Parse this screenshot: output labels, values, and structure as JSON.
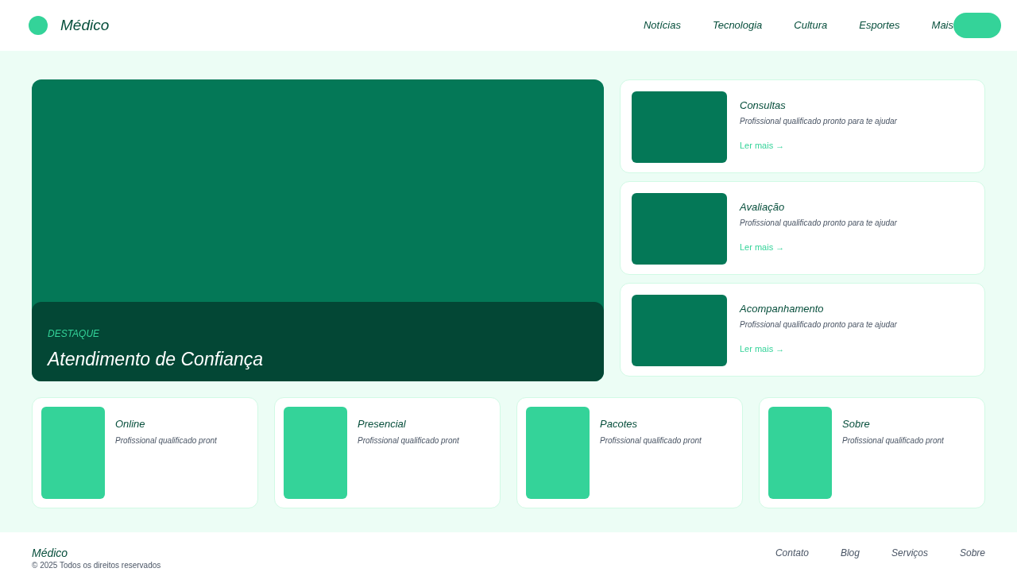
{
  "header": {
    "brand": "Médico",
    "nav": [
      "Notícias",
      "Tecnologia",
      "Cultura",
      "Esportes",
      "Mais"
    ]
  },
  "hero": {
    "eyebrow": "DESTAQUE",
    "title": "Atendimento de Confiança"
  },
  "side_cards": [
    {
      "title": "Consultas",
      "text": "Profissional qualificado pronto para te ajudar",
      "link": "Ler mais →"
    },
    {
      "title": "Avaliação",
      "text": "Profissional qualificado pronto para te ajudar",
      "link": "Ler mais →"
    },
    {
      "title": "Acompanhamento",
      "text": "Profissional qualificado pronto para te ajudar",
      "link": "Ler mais →"
    }
  ],
  "bottom_cards": [
    {
      "title": "Online",
      "text": "Profissional qualificado pront"
    },
    {
      "title": "Presencial",
      "text": "Profissional qualificado pront"
    },
    {
      "title": "Pacotes",
      "text": "Profissional qualificado pront"
    },
    {
      "title": "Sobre",
      "text": "Profissional qualificado pront"
    }
  ],
  "footer": {
    "brand": "Médico",
    "copyright": "© 2025 Todos os direitos reservados",
    "links": [
      "Contato",
      "Blog",
      "Serviços",
      "Sobre"
    ]
  }
}
